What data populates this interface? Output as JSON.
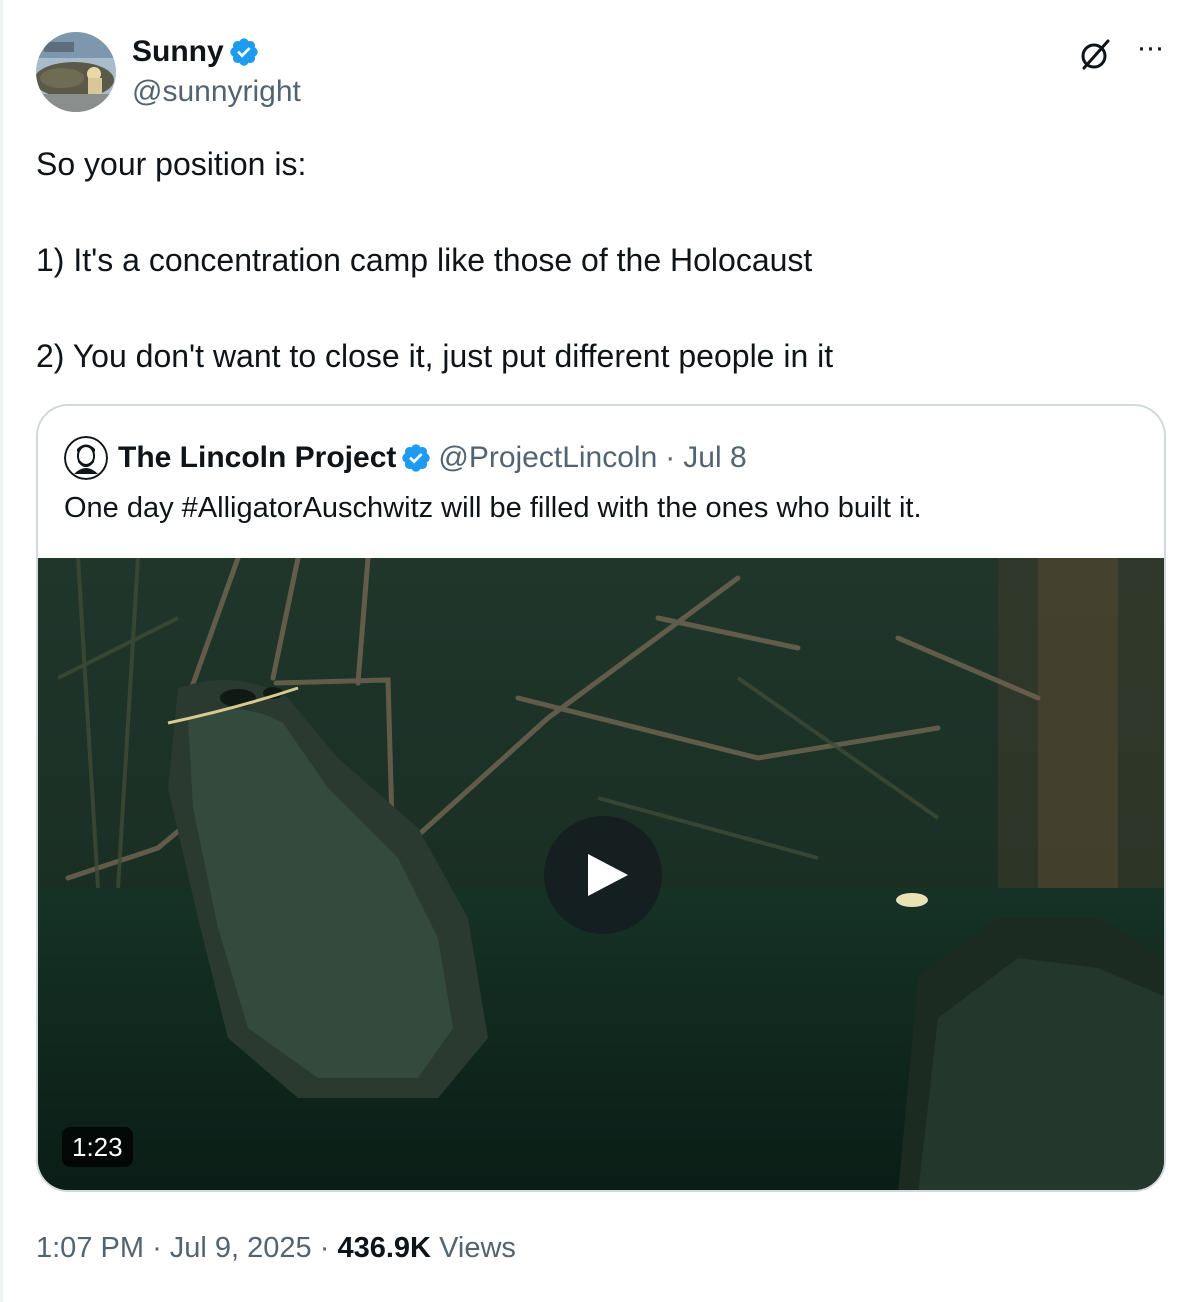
{
  "author": {
    "display_name": "Sunny",
    "handle": "@sunnyright",
    "verified_color": "#1d9bf0"
  },
  "icons": {
    "grok": "grok-icon",
    "more": "more-icon",
    "verified": "verified-badge-icon",
    "play": "play-icon"
  },
  "tweet": {
    "text": "So your position is:\n\n1) It's a concentration camp like those of the Holocaust\n\n2) You don't want to close it, just put different people in it"
  },
  "quote": {
    "display_name": "The Lincoln Project",
    "handle": "@ProjectLincoln",
    "separator": "·",
    "date": "Jul 8",
    "text": "One day #AlligatorAuschwitz will be filled with the ones who built it.",
    "video": {
      "duration": "1:23"
    }
  },
  "meta": {
    "time": "1:07 PM",
    "separator": "·",
    "date": "Jul 9, 2025",
    "views_count": "436.9K",
    "views_label": "Views"
  }
}
